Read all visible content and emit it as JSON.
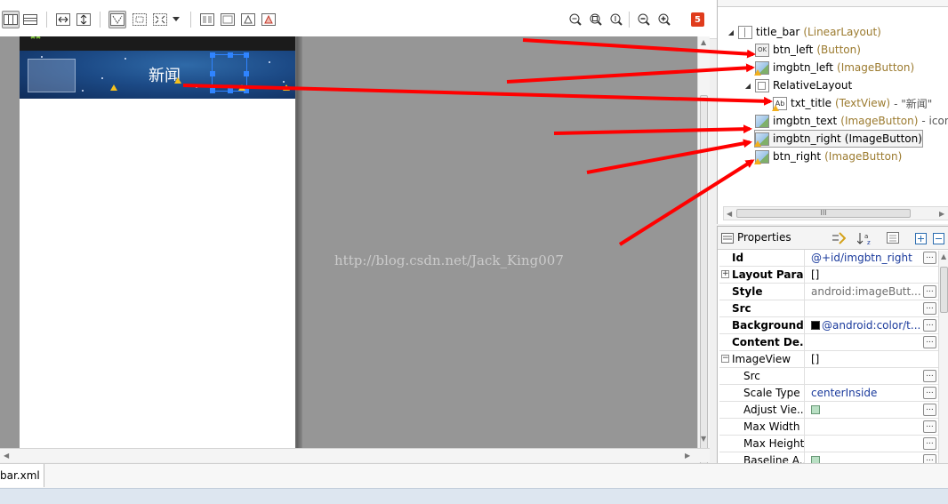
{
  "toolbar": {
    "icons": [
      "layout-horizontal-icon",
      "layout-vertical-icon",
      "fit-width-icon",
      "fit-height-icon",
      "show-bounds-icon",
      "grid-icon",
      "resize-icon",
      "dropdown-arrow-icon",
      "layout-a-icon",
      "layout-b-icon",
      "layout-c-icon",
      "layout-d-icon",
      "zoom-fit-icon",
      "zoom-real-icon",
      "zoom-100-icon",
      "zoom-out-icon",
      "zoom-in-icon"
    ],
    "error_badge": "5"
  },
  "preview": {
    "title": "新闻",
    "watermark": "http://blog.csdn.net/Jack_King007",
    "titlebar_color": "#1c4a86"
  },
  "outline": {
    "items": [
      {
        "name": "title_bar",
        "type": "(LinearLayout)",
        "extra": "",
        "icon": "linearlayout-icon"
      },
      {
        "name": "btn_left",
        "type": "(Button)",
        "extra": "",
        "icon": "button-icon"
      },
      {
        "name": "imgbtn_left",
        "type": "(ImageButton)",
        "extra": "",
        "icon": "imagebutton-icon"
      },
      {
        "name": "RelativeLayout",
        "type": "",
        "extra": "",
        "icon": "relativelayout-icon"
      },
      {
        "name": "txt_title",
        "type": "(TextView)",
        "extra": "- \"新闻\"",
        "icon": "textview-icon"
      },
      {
        "name": "imgbtn_text",
        "type": "(ImageButton)",
        "extra": "- icon_",
        "icon": "imagebutton-icon"
      },
      {
        "name": "imgbtn_right",
        "type": "(ImageButton)",
        "extra": "",
        "icon": "imagebutton-icon"
      },
      {
        "name": "btn_right",
        "type": "(ImageButton)",
        "extra": "",
        "icon": "imagebutton-icon"
      }
    ],
    "scroll_grip": "III"
  },
  "properties": {
    "title": "Properties",
    "rows": [
      {
        "name": "Id",
        "value": "@+id/imgbtn_right"
      },
      {
        "name": "Layout Para...",
        "value": "[]"
      },
      {
        "name": "Style",
        "value": "android:imageButt..."
      },
      {
        "name": "Src",
        "value": ""
      },
      {
        "name": "Background",
        "value": "@android:color/t..."
      },
      {
        "name": "Content De...",
        "value": ""
      },
      {
        "name": "ImageView",
        "value": "[]"
      },
      {
        "name": "Src",
        "value": ""
      },
      {
        "name": "Scale Type",
        "value": "centerInside"
      },
      {
        "name": "Adjust Vie...",
        "value": ""
      },
      {
        "name": "Max Width",
        "value": ""
      },
      {
        "name": "Max Height",
        "value": ""
      },
      {
        "name": "Baseline A...",
        "value": ""
      }
    ],
    "ellipsis": "...",
    "expand": "+",
    "collapse": "−"
  },
  "editor_tab": {
    "label": "bar.xml"
  },
  "colors": {
    "arrow": "#ff0000",
    "selection": "#2f84ff",
    "canvas": "#969696"
  }
}
